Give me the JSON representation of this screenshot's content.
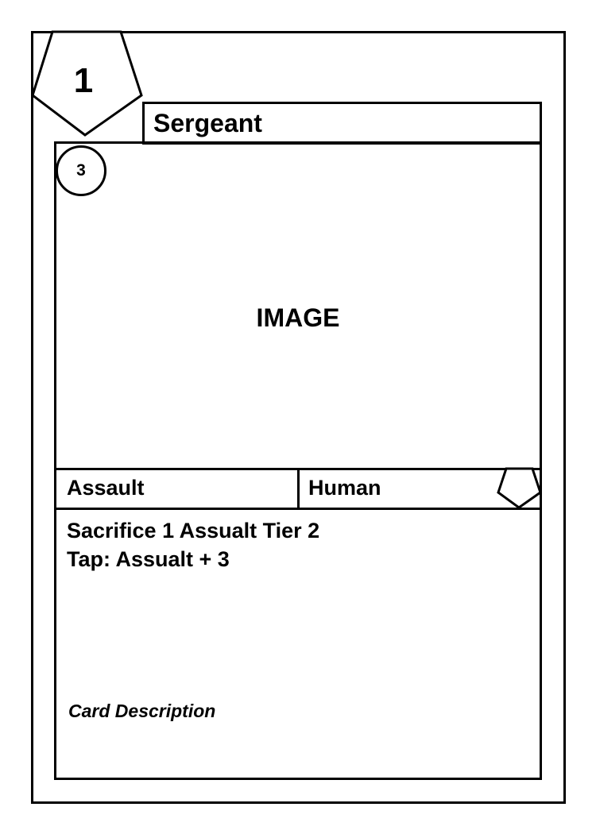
{
  "tier_badge": {
    "value": "1",
    "icon": "pentagon-icon"
  },
  "card_name": "Sergeant",
  "cost_badge": {
    "value": "3",
    "icon": "circle-icon"
  },
  "art_placeholder": "IMAGE",
  "type_line": {
    "left": "Assault",
    "right": "Human",
    "corner_icon": "pentagon-icon"
  },
  "rules_text": {
    "line1": "Sacrifice 1 Assualt Tier 2",
    "line2": "Tap: Assualt + 3"
  },
  "flavor_text": "Card Description"
}
